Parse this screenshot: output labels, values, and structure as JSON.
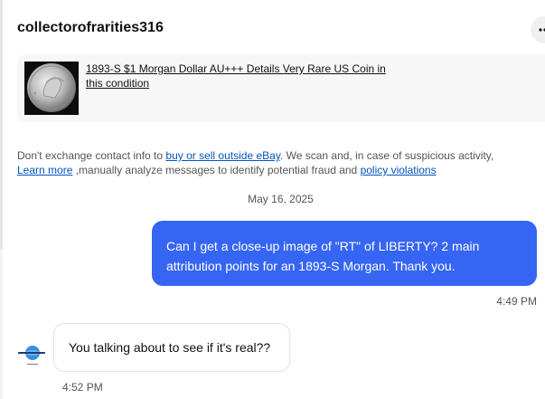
{
  "header": {
    "username": "collectorofrarities316",
    "more_icon": "ellipsis-icon"
  },
  "listing": {
    "title": "1893-S $1 Morgan Dollar AU+++ Details Very Rare US Coin in this condition",
    "thumbnail_icon": "coin-image"
  },
  "notice": {
    "text_1": "Don't exchange contact info to ",
    "link_1": "buy or sell outside eBay",
    "text_2": ". We scan and, in case of suspicious activity, ",
    "link_2": "Learn more",
    "text_3": " ,manually analyze messages to identify potential fraud and ",
    "link_3": "policy violations"
  },
  "conversation": {
    "date": "May 16, 2025",
    "messages": [
      {
        "direction": "outgoing",
        "text": "Can I get a close-up image of \"RT\" of LIBERTY? 2 main attribution points for an 1893-S Morgan. Thank you.",
        "time": "4:49 PM"
      },
      {
        "direction": "incoming",
        "text": "You talking about to see if it's real??",
        "time": "4:52 PM"
      }
    ]
  },
  "colors": {
    "outgoing_bubble": "#3665f3",
    "link": "#0654ba",
    "card_background": "#f7f7f7"
  }
}
